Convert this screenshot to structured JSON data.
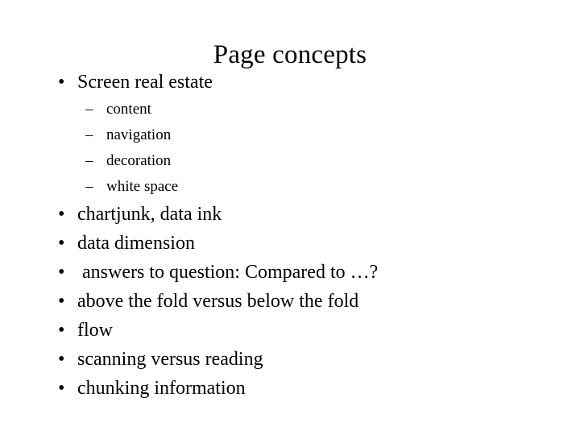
{
  "slide": {
    "title": "Page concepts",
    "background_color": "#ffffff",
    "text_color": "#000000",
    "bullet_marker": "•",
    "sub_bullet_marker": "–",
    "outline": [
      {
        "level": 1,
        "text": "Screen real estate",
        "children": [
          {
            "level": 2,
            "text": "content"
          },
          {
            "level": 2,
            "text": "navigation"
          },
          {
            "level": 2,
            "text": "decoration"
          },
          {
            "level": 2,
            "text": "white space"
          }
        ]
      },
      {
        "level": 1,
        "text": "chartjunk, data ink",
        "children": []
      },
      {
        "level": 1,
        "text": "data dimension",
        "children": []
      },
      {
        "level": 1,
        "text": " answers to question: Compared to …?",
        "children": []
      },
      {
        "level": 1,
        "text": "above the fold versus below the fold",
        "children": []
      },
      {
        "level": 1,
        "text": "flow",
        "children": []
      },
      {
        "level": 1,
        "text": "scanning versus reading",
        "children": []
      },
      {
        "level": 1,
        "text": "chunking information",
        "children": []
      }
    ]
  }
}
